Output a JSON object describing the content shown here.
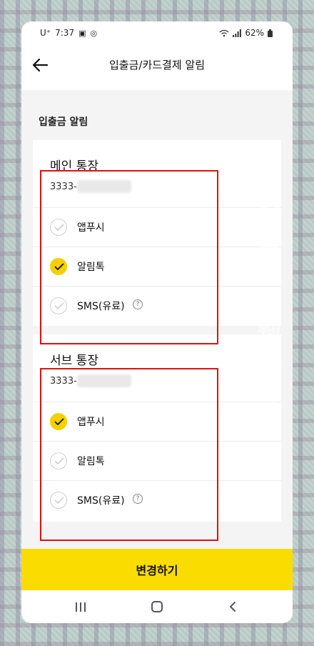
{
  "status_bar": {
    "carrier": "U⁺",
    "time": "7:37",
    "battery": "62%"
  },
  "header": {
    "title": "입출금/카드결제 알림"
  },
  "section": {
    "title": "입출금 알림"
  },
  "accounts": [
    {
      "name": "메인 통장",
      "number": "3333-",
      "options": [
        {
          "label": "앱푸시",
          "checked": false
        },
        {
          "label": "알림톡",
          "checked": true
        },
        {
          "label": "SMS(유료)",
          "checked": false,
          "help": "?"
        }
      ]
    },
    {
      "name": "서브 통장",
      "number": "3333-",
      "options": [
        {
          "label": "앱푸시",
          "checked": true
        },
        {
          "label": "알림톡",
          "checked": false
        },
        {
          "label": "SMS(유료)",
          "checked": false,
          "help": "?"
        }
      ]
    }
  ],
  "cta": {
    "label": "변경하기"
  },
  "watermark": "엉클샘의웹자료실",
  "colors": {
    "accent": "#fbdc00",
    "highlight_box": "#e01010"
  }
}
